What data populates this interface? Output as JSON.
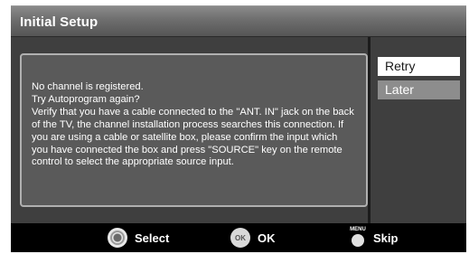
{
  "dialog": {
    "title": "Initial Setup",
    "message": "No channel is registered.\nTry Autoprogram again?\nVerify that you have a cable connected to the \"ANT. IN\" jack on the  back\nof the TV, the channel installation process searches this connection. If\nyou are using a cable or satellite box, please confirm the input which\nyou have connected the box and press \"SOURCE\" key on the remote\ncontrol to select the appropriate source input."
  },
  "options": [
    {
      "label": "Retry",
      "selected": true
    },
    {
      "label": "Later",
      "selected": false
    }
  ],
  "footer": {
    "select_label": "Select",
    "ok_icon_text": "OK",
    "ok_label": "OK",
    "menu_icon_text": "MENU",
    "skip_label": "Skip"
  },
  "icons": {
    "select": "dpad-icon",
    "ok": "ok-button-icon",
    "menu": "menu-button-icon"
  },
  "colors": {
    "title_bar": "#6e6e6e",
    "panel": "#3f3f3f",
    "selected_option_bg": "#ffffff",
    "unselected_option_bg": "#8d8d8d",
    "footer_bg": "#000000"
  }
}
